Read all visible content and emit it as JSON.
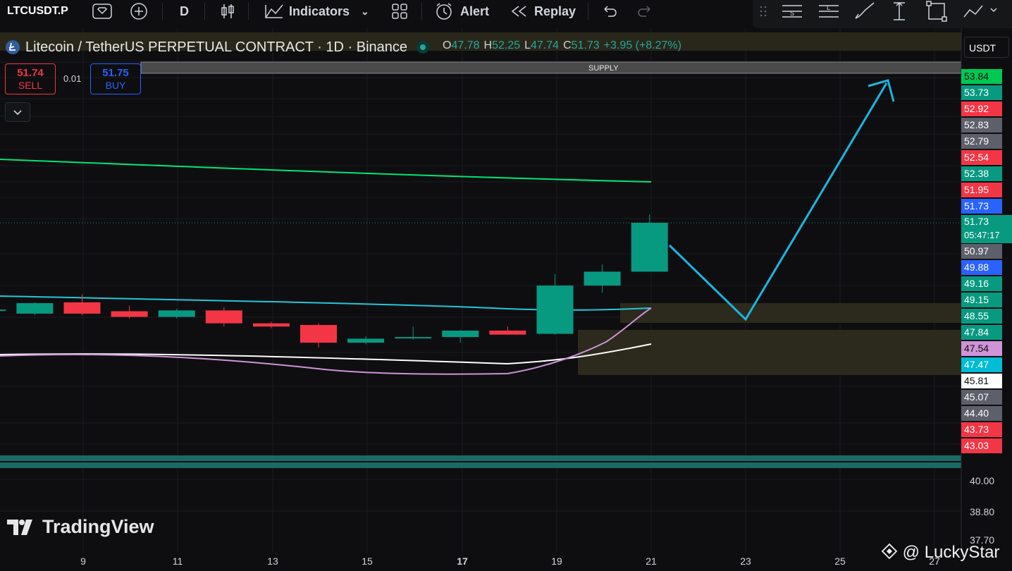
{
  "toolbar": {
    "symbol": "LTCUSDT.P",
    "interval": "D",
    "indicators_label": "Indicators",
    "alert_label": "Alert",
    "replay_label": "Replay"
  },
  "legend": {
    "title": "Litecoin / TetherUS PERPETUAL CONTRACT · 1D · Binance",
    "open_key": "O",
    "open": "47.78",
    "high_key": "H",
    "high": "52.25",
    "low_key": "L",
    "low": "47.74",
    "close_key": "C",
    "close": "51.73",
    "change": "+3.95 (+8.27%)"
  },
  "trade": {
    "sell_price": "51.74",
    "sell_label": "SELL",
    "spread": "0.01",
    "buy_price": "51.75",
    "buy_label": "BUY"
  },
  "currency": "USDT",
  "supply_label": "SUPPLY",
  "watermark": "TradingView",
  "author": "@ LuckyStar",
  "countdown": "05:47:17",
  "price_tags": [
    {
      "v": "53.84",
      "bg": "#00c853",
      "fg": "#0e0e10"
    },
    {
      "v": "53.73",
      "bg": "#089981",
      "fg": "#ffffff"
    },
    {
      "v": "52.92",
      "bg": "#f23645",
      "fg": "#ffffff"
    },
    {
      "v": "52.83",
      "bg": "#5d606b",
      "fg": "#ffffff"
    },
    {
      "v": "52.79",
      "bg": "#5d606b",
      "fg": "#ffffff"
    },
    {
      "v": "52.54",
      "bg": "#f23645",
      "fg": "#ffffff"
    },
    {
      "v": "52.38",
      "bg": "#089981",
      "fg": "#ffffff"
    },
    {
      "v": "51.95",
      "bg": "#f23645",
      "fg": "#ffffff"
    },
    {
      "v": "51.73",
      "bg": "#2962ff",
      "fg": "#ffffff"
    },
    {
      "v": "51.73",
      "bg": "#089981",
      "fg": "#ffffff"
    },
    {
      "v": "50.97",
      "bg": "#5d606b",
      "fg": "#ffffff"
    },
    {
      "v": "49.88",
      "bg": "#2962ff",
      "fg": "#ffffff"
    },
    {
      "v": "49.16",
      "bg": "#089981",
      "fg": "#ffffff"
    },
    {
      "v": "49.15",
      "bg": "#089981",
      "fg": "#ffffff"
    },
    {
      "v": "48.55",
      "bg": "#089981",
      "fg": "#ffffff"
    },
    {
      "v": "47.84",
      "bg": "#089981",
      "fg": "#ffffff"
    },
    {
      "v": "47.54",
      "bg": "#ce93d8",
      "fg": "#0e0e10"
    },
    {
      "v": "47.47",
      "bg": "#00bcd4",
      "fg": "#ffffff"
    },
    {
      "v": "45.81",
      "bg": "#ffffff",
      "fg": "#0e0e10"
    },
    {
      "v": "45.07",
      "bg": "#5d606b",
      "fg": "#ffffff"
    },
    {
      "v": "44.40",
      "bg": "#5d606b",
      "fg": "#ffffff"
    },
    {
      "v": "43.73",
      "bg": "#f23645",
      "fg": "#ffffff"
    },
    {
      "v": "43.03",
      "bg": "#f23645",
      "fg": "#ffffff"
    }
  ],
  "price_axis_ticks": [
    "40.00",
    "38.80",
    "37.70"
  ],
  "x_labels": [
    "9",
    "11",
    "13",
    "15",
    "17",
    "19",
    "21",
    "23",
    "25",
    "27"
  ],
  "colors": {
    "up": "#089981",
    "down": "#f23645",
    "ma_green": "#00e676",
    "ma_cyan": "#26c6da",
    "ma_white": "#ffffff",
    "ma_pink": "#ce93d8",
    "arrow": "#1cb5e0",
    "zone": "#2b2a1c"
  },
  "chart_data": {
    "type": "candlestick",
    "x": [
      "7",
      "8",
      "9",
      "10",
      "11",
      "12",
      "13",
      "14",
      "15",
      "16",
      "17",
      "18",
      "19",
      "20",
      "21"
    ],
    "candles": [
      {
        "o": 46.3,
        "h": 46.4,
        "l": 46.1,
        "c": 46.35
      },
      {
        "o": 46.1,
        "h": 46.8,
        "l": 46.0,
        "c": 46.75
      },
      {
        "o": 46.8,
        "h": 47.3,
        "l": 46.0,
        "c": 46.1
      },
      {
        "o": 46.25,
        "h": 46.6,
        "l": 45.8,
        "c": 45.9
      },
      {
        "o": 45.9,
        "h": 46.4,
        "l": 45.8,
        "c": 46.3
      },
      {
        "o": 46.3,
        "h": 46.5,
        "l": 45.3,
        "c": 45.5
      },
      {
        "o": 45.5,
        "h": 45.6,
        "l": 45.2,
        "c": 45.3
      },
      {
        "o": 45.4,
        "h": 45.5,
        "l": 44.0,
        "c": 44.3
      },
      {
        "o": 44.3,
        "h": 44.7,
        "l": 44.2,
        "c": 44.55
      },
      {
        "o": 44.6,
        "h": 45.3,
        "l": 44.5,
        "c": 44.65
      },
      {
        "o": 44.65,
        "h": 45.1,
        "l": 44.3,
        "c": 45.05
      },
      {
        "o": 45.05,
        "h": 45.3,
        "l": 44.8,
        "c": 44.8
      },
      {
        "o": 44.85,
        "h": 48.55,
        "l": 44.8,
        "c": 47.84
      },
      {
        "o": 47.84,
        "h": 49.16,
        "l": 47.4,
        "c": 48.7
      },
      {
        "o": 48.7,
        "h": 52.25,
        "l": 48.7,
        "c": 51.73
      }
    ]
  }
}
